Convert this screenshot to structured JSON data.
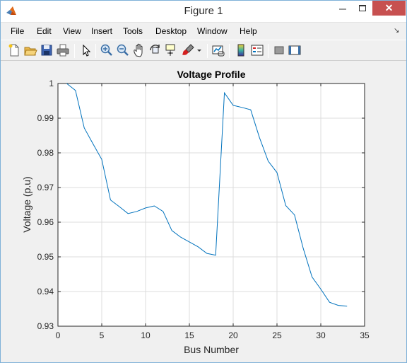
{
  "window": {
    "title": "Figure 1",
    "close_symbol": "✕"
  },
  "menu": {
    "items": [
      "File",
      "Edit",
      "View",
      "Insert",
      "Tools",
      "Desktop",
      "Window",
      "Help"
    ],
    "dock_arrow": "↘"
  },
  "toolbar": {
    "icons": [
      "new-figure-icon",
      "open-file-icon",
      "save-icon",
      "print-icon",
      "edit-plot-icon",
      "zoom-in-icon",
      "zoom-out-icon",
      "pan-icon",
      "rotate-3d-icon",
      "data-cursor-icon",
      "brush-icon",
      "brush-dropdown-icon",
      "link-plot-icon",
      "insert-colorbar-icon",
      "insert-legend-icon",
      "hide-plot-tools-icon",
      "show-plot-tools-icon"
    ]
  },
  "colors": {
    "line": "#0072bd",
    "grid": "#dcdcdc",
    "axes": "#262626",
    "close_button": "#c75050"
  },
  "chart_data": {
    "type": "line",
    "title": "Voltage Profile",
    "xlabel": "Bus Number",
    "ylabel": "Voltage (p.u)",
    "xlim": [
      0,
      35
    ],
    "ylim": [
      0.93,
      1
    ],
    "xticks": [
      0,
      5,
      10,
      15,
      20,
      25,
      30,
      35
    ],
    "yticks": [
      0.93,
      0.94,
      0.95,
      0.96,
      0.97,
      0.98,
      0.99,
      1
    ],
    "grid": true,
    "series": [
      {
        "x": [
          1,
          2,
          3,
          4,
          5,
          6,
          7,
          8,
          9,
          10,
          11,
          12,
          13,
          14,
          15,
          16,
          17,
          18,
          19,
          20,
          21,
          22,
          23,
          24,
          25,
          26,
          27,
          28,
          29,
          30,
          31,
          32,
          33
        ],
        "y": [
          1.0,
          0.998,
          0.9872,
          0.9826,
          0.9781,
          0.9664,
          0.9645,
          0.9625,
          0.9631,
          0.9641,
          0.9647,
          0.9631,
          0.9576,
          0.9557,
          0.9543,
          0.9529,
          0.951,
          0.9505,
          0.9973,
          0.9937,
          0.9931,
          0.9924,
          0.9844,
          0.9776,
          0.9743,
          0.9648,
          0.9621,
          0.9524,
          0.9442,
          0.9407,
          0.9369,
          0.936,
          0.9358
        ]
      }
    ]
  }
}
